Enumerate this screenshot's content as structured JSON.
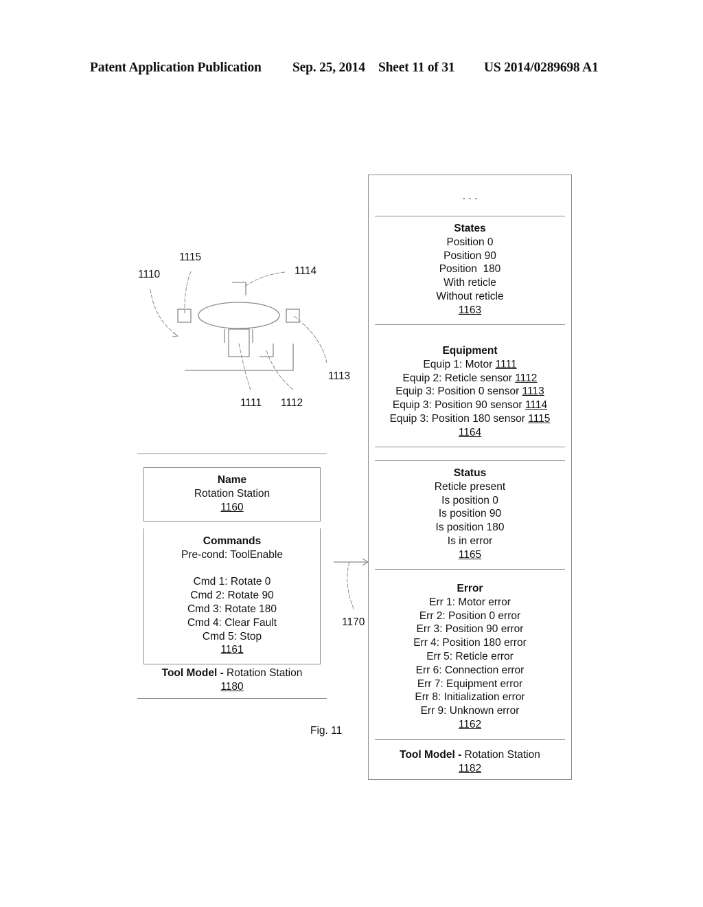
{
  "header": {
    "publication": "Patent Application Publication",
    "date": "Sep. 25, 2014",
    "sheet": "Sheet 11 of 31",
    "number": "US 2014/0289698 A1"
  },
  "figure": {
    "caption": "Fig. 11",
    "drawing_labels": {
      "station": "1110",
      "sensor_180": "1115",
      "sensor_90": "1114",
      "sensor_0": "1113",
      "motor": "1111",
      "reticle_sensor": "1112"
    },
    "arrow_label": "1170",
    "left_model": {
      "name_block": {
        "title": "Name",
        "lines": [
          "Rotation Station"
        ],
        "ref": "1160"
      },
      "commands_block": {
        "title": "Commands",
        "precondition": "Pre-cond: ToolEnable",
        "lines": [
          "Cmd 1: Rotate 0",
          "Cmd 2: Rotate 90",
          "Cmd 3: Rotate 180",
          "Cmd 4: Clear Fault",
          "Cmd 5: Stop"
        ],
        "ref": "1161"
      },
      "footer": {
        "bold": "Tool Model -",
        "text": " Rotation Station",
        "ref": "1180"
      }
    },
    "right_model": {
      "ellipsis": ". . .",
      "states": {
        "title": "States",
        "lines": [
          "Position 0",
          "Position 90",
          "Position  180",
          "With reticle",
          "Without reticle"
        ],
        "ref": "1163"
      },
      "equipment": {
        "title": "Equipment",
        "items": [
          {
            "text": "Equip 1: Motor ",
            "ref": "1111"
          },
          {
            "text": "Equip 2: Reticle sensor ",
            "ref": "1112"
          },
          {
            "text": "Equip 3: Position 0 sensor ",
            "ref": "1113"
          },
          {
            "text": "Equip 3: Position 90 sensor ",
            "ref": "1114"
          },
          {
            "text": "Equip 3: Position 180 sensor ",
            "ref": "1115"
          }
        ],
        "ref": "1164"
      },
      "status": {
        "title": "Status",
        "lines": [
          "Reticle present",
          "Is position 0",
          "Is position 90",
          "Is position 180",
          "Is in error"
        ],
        "ref": "1165"
      },
      "error": {
        "title": "Error",
        "lines": [
          "Err 1: Motor error",
          "Err 2: Position 0 error",
          "Err 3: Position 90 error",
          "Err 4: Position 180 error",
          "Err 5: Reticle error",
          "Err 6: Connection error",
          "Err 7: Equipment error",
          "Err 8: Initialization error",
          "Err 9: Unknown error"
        ],
        "ref": "1162"
      },
      "footer": {
        "bold": "Tool Model -",
        "text": " Rotation Station",
        "ref": "1182"
      }
    }
  }
}
